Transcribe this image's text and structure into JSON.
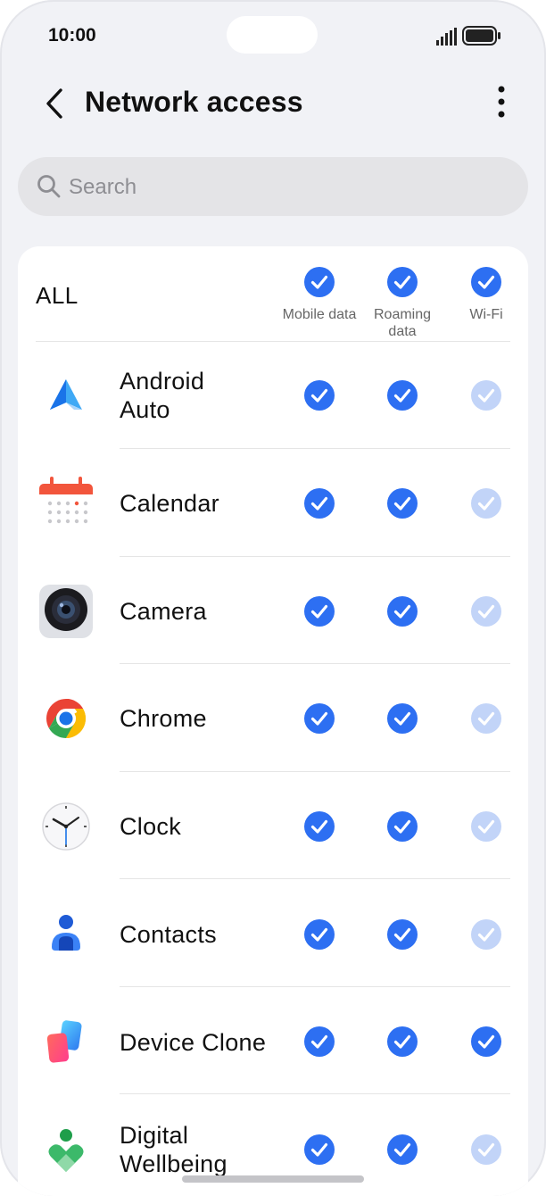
{
  "status": {
    "time": "10:00"
  },
  "header": {
    "title": "Network access"
  },
  "search": {
    "placeholder": "Search"
  },
  "columns": {
    "all_label": "ALL",
    "mobile": "Mobile data",
    "roaming_1": "Roaming",
    "roaming_2": "data",
    "wifi": "Wi-Fi"
  },
  "apps": [
    {
      "line1": "Android",
      "line2": "Auto",
      "icon": "android-auto-icon",
      "mobile": true,
      "roaming": true,
      "wifi": false
    },
    {
      "line1": "Calendar",
      "line2": "",
      "icon": "calendar-icon",
      "mobile": true,
      "roaming": true,
      "wifi": false
    },
    {
      "line1": "Camera",
      "line2": "",
      "icon": "camera-icon",
      "mobile": true,
      "roaming": true,
      "wifi": false
    },
    {
      "line1": "Chrome",
      "line2": "",
      "icon": "chrome-icon",
      "mobile": true,
      "roaming": true,
      "wifi": false
    },
    {
      "line1": "Clock",
      "line2": "",
      "icon": "clock-icon",
      "mobile": true,
      "roaming": true,
      "wifi": false
    },
    {
      "line1": "Contacts",
      "line2": "",
      "icon": "contacts-icon",
      "mobile": true,
      "roaming": true,
      "wifi": false
    },
    {
      "line1": "Device Clone",
      "line2": "",
      "icon": "device-clone-icon",
      "mobile": true,
      "roaming": true,
      "wifi": true
    },
    {
      "line1": "Digital",
      "line2": "Wellbeing",
      "icon": "digital-wellbeing-icon",
      "mobile": true,
      "roaming": true,
      "wifi": false
    }
  ],
  "colors": {
    "accent": "#2d6ff2",
    "accent_disabled": "#c2d4f8",
    "background": "#f1f2f6"
  }
}
